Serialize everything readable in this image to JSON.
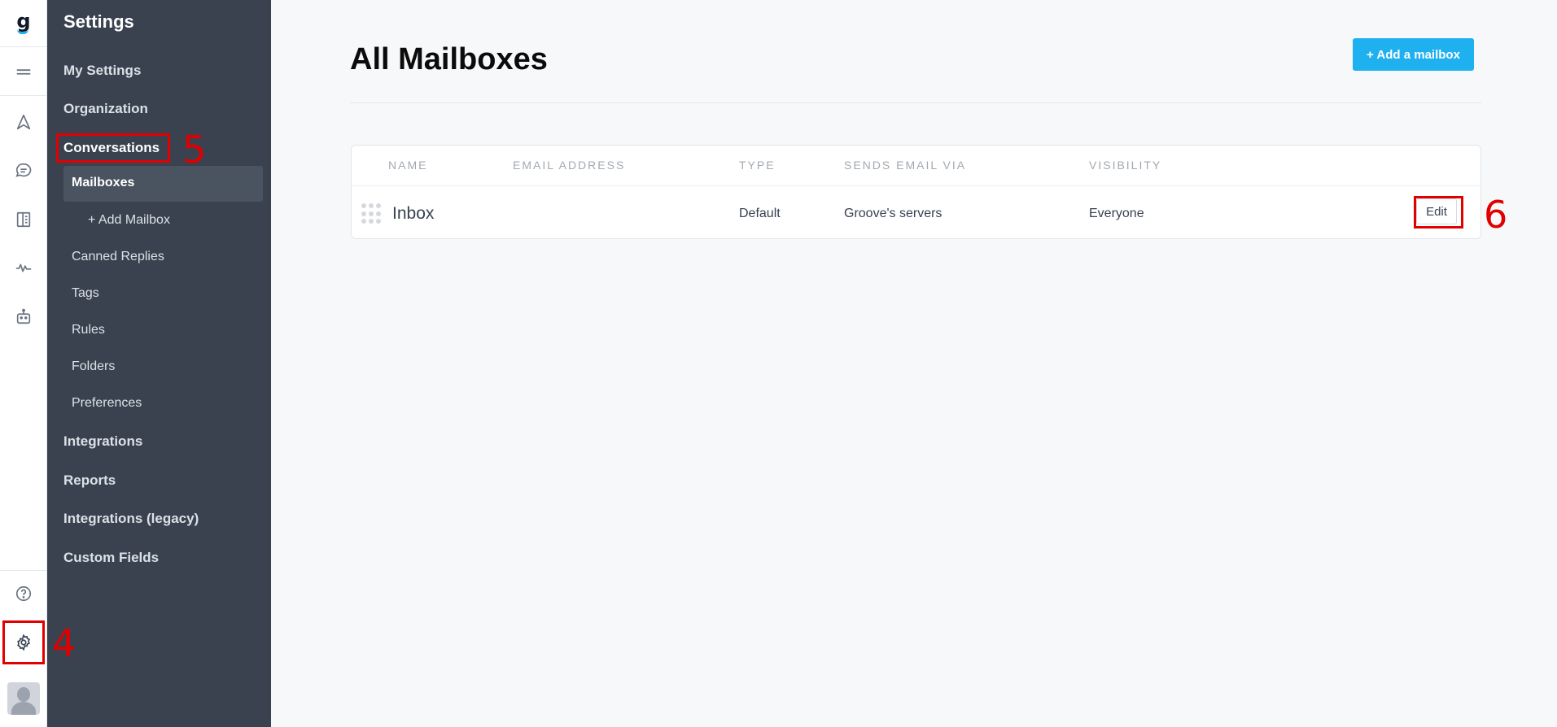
{
  "app": {
    "logo_letter": "g",
    "brand_color": "#1fb0f0"
  },
  "rail": {
    "icons": [
      {
        "name": "menu-icon"
      },
      {
        "name": "send-icon"
      },
      {
        "name": "chat-icon"
      },
      {
        "name": "book-icon"
      },
      {
        "name": "activity-icon"
      },
      {
        "name": "bot-icon"
      },
      {
        "name": "help-icon"
      },
      {
        "name": "gear-icon"
      }
    ]
  },
  "sidebar": {
    "title": "Settings",
    "items": [
      {
        "label": "My Settings"
      },
      {
        "label": "Organization"
      },
      {
        "label": "Conversations"
      },
      {
        "label": "Mailboxes"
      },
      {
        "label": "+ Add Mailbox"
      },
      {
        "label": "Canned Replies"
      },
      {
        "label": "Tags"
      },
      {
        "label": "Rules"
      },
      {
        "label": "Folders"
      },
      {
        "label": "Preferences"
      },
      {
        "label": "Integrations"
      },
      {
        "label": "Reports"
      },
      {
        "label": "Integrations (legacy)"
      },
      {
        "label": "Custom Fields"
      }
    ]
  },
  "main": {
    "title": "All Mailboxes",
    "add_button": "+ Add a mailbox",
    "table": {
      "columns": [
        "NAME",
        "EMAIL ADDRESS",
        "TYPE",
        "SENDS EMAIL VIA",
        "VISIBILITY"
      ],
      "rows": [
        {
          "name": "Inbox",
          "email": "",
          "type": "Default",
          "sends_via": "Groove's servers",
          "visibility": "Everyone",
          "action": "Edit"
        }
      ]
    }
  },
  "annotations": {
    "marker_color": "#e10000",
    "labels": [
      "4",
      "5",
      "6"
    ]
  }
}
